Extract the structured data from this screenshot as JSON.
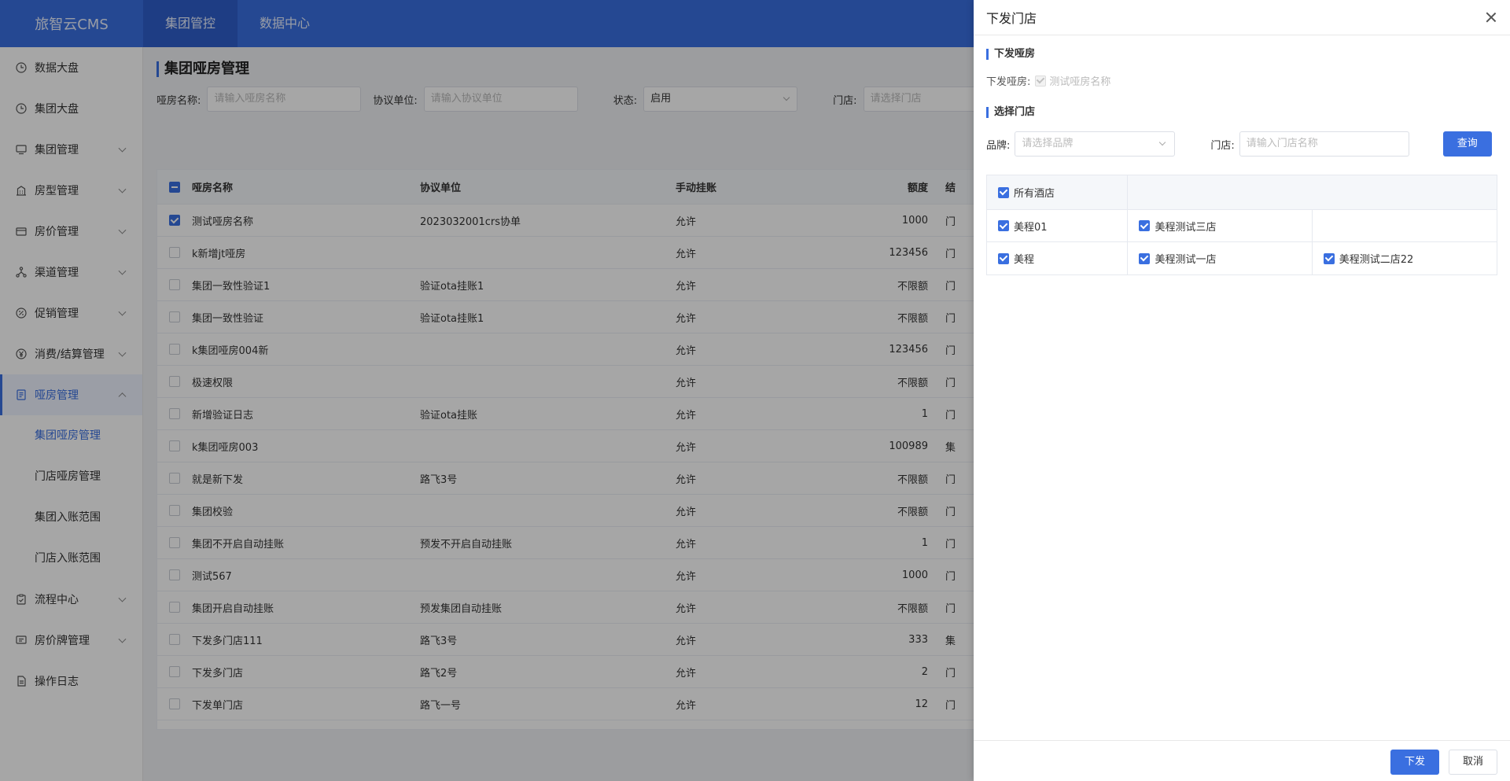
{
  "app": {
    "logo": "旅智云CMS"
  },
  "topnav": [
    {
      "label": "集团管控"
    },
    {
      "label": "数据中心"
    }
  ],
  "sidebar": {
    "items": [
      {
        "label": "数据大盘"
      },
      {
        "label": "集团大盘"
      },
      {
        "label": "集团管理"
      },
      {
        "label": "房型管理"
      },
      {
        "label": "房价管理"
      },
      {
        "label": "渠道管理"
      },
      {
        "label": "促销管理"
      },
      {
        "label": "消费/结算管理"
      },
      {
        "label": "哑房管理"
      },
      {
        "label": "流程中心"
      },
      {
        "label": "房价牌管理"
      },
      {
        "label": "操作日志"
      }
    ],
    "sub": [
      {
        "label": "集团哑房管理"
      },
      {
        "label": "门店哑房管理"
      },
      {
        "label": "集团入账范围"
      },
      {
        "label": "门店入账范围"
      }
    ]
  },
  "main": {
    "title": "集团哑房管理",
    "filters": {
      "name_label": "哑房名称:",
      "name_placeholder": "请输入哑房名称",
      "unit_label": "协议单位:",
      "unit_placeholder": "请输入协议单位",
      "status_label": "状态:",
      "status_value": "启用",
      "store_label": "门店:",
      "store_placeholder": "请选择门店"
    },
    "table": {
      "headers": {
        "name": "哑房名称",
        "unit": "协议单位",
        "hang": "手动挂账",
        "amount": "额度",
        "end": "结"
      },
      "rows": [
        {
          "name": "测试哑房名称",
          "unit": "2023032001crs协单",
          "hang": "允许",
          "amount": "1000",
          "end": "门"
        },
        {
          "name": "k新增jt哑房",
          "unit": "",
          "hang": "允许",
          "amount": "123456",
          "end": "门"
        },
        {
          "name": "集团一致性验证1",
          "unit": "验证ota挂账1",
          "hang": "允许",
          "amount": "不限额",
          "end": "门"
        },
        {
          "name": "集团一致性验证",
          "unit": "验证ota挂账1",
          "hang": "允许",
          "amount": "不限额",
          "end": "门"
        },
        {
          "name": "k集团哑房004新",
          "unit": "",
          "hang": "允许",
          "amount": "123456",
          "end": "门"
        },
        {
          "name": "极速权限",
          "unit": "",
          "hang": "允许",
          "amount": "不限额",
          "end": "门"
        },
        {
          "name": "新增验证日志",
          "unit": "验证ota挂账",
          "hang": "允许",
          "amount": "1",
          "end": "门"
        },
        {
          "name": "k集团哑房003",
          "unit": "",
          "hang": "允许",
          "amount": "100989",
          "end": "集"
        },
        {
          "name": "就是新下发",
          "unit": "路飞3号",
          "hang": "允许",
          "amount": "不限额",
          "end": "门"
        },
        {
          "name": "集团校验",
          "unit": "",
          "hang": "允许",
          "amount": "不限额",
          "end": "门"
        },
        {
          "name": "集团不开启自动挂账",
          "unit": "预发不开启自动挂账",
          "hang": "允许",
          "amount": "1",
          "end": "门"
        },
        {
          "name": "测试567",
          "unit": "",
          "hang": "允许",
          "amount": "1000",
          "end": "门"
        },
        {
          "name": "集团开启自动挂账",
          "unit": "预发集团自动挂账",
          "hang": "允许",
          "amount": "不限额",
          "end": "门"
        },
        {
          "name": "下发多门店111",
          "unit": "路飞3号",
          "hang": "允许",
          "amount": "333",
          "end": "集"
        },
        {
          "name": "下发多门店",
          "unit": "路飞2号",
          "hang": "允许",
          "amount": "2",
          "end": "门"
        },
        {
          "name": "下发单门店",
          "unit": "路飞一号",
          "hang": "允许",
          "amount": "12",
          "end": "门"
        }
      ]
    }
  },
  "drawer": {
    "title": "下发门店",
    "sec1": "下发哑房",
    "room_label": "下发哑房:",
    "room_value": "测试哑房名称",
    "sec2": "选择门店",
    "brand_label": "品牌:",
    "brand_placeholder": "请选择品牌",
    "store_label": "门店:",
    "store_placeholder": "请输入门店名称",
    "query": "查询",
    "all_hotels": "所有酒店",
    "hotels": [
      [
        "美程01",
        "美程测试三店",
        ""
      ],
      [
        "美程",
        "美程测试一店",
        "美程测试二店22"
      ]
    ],
    "submit": "下发",
    "cancel": "取消"
  }
}
